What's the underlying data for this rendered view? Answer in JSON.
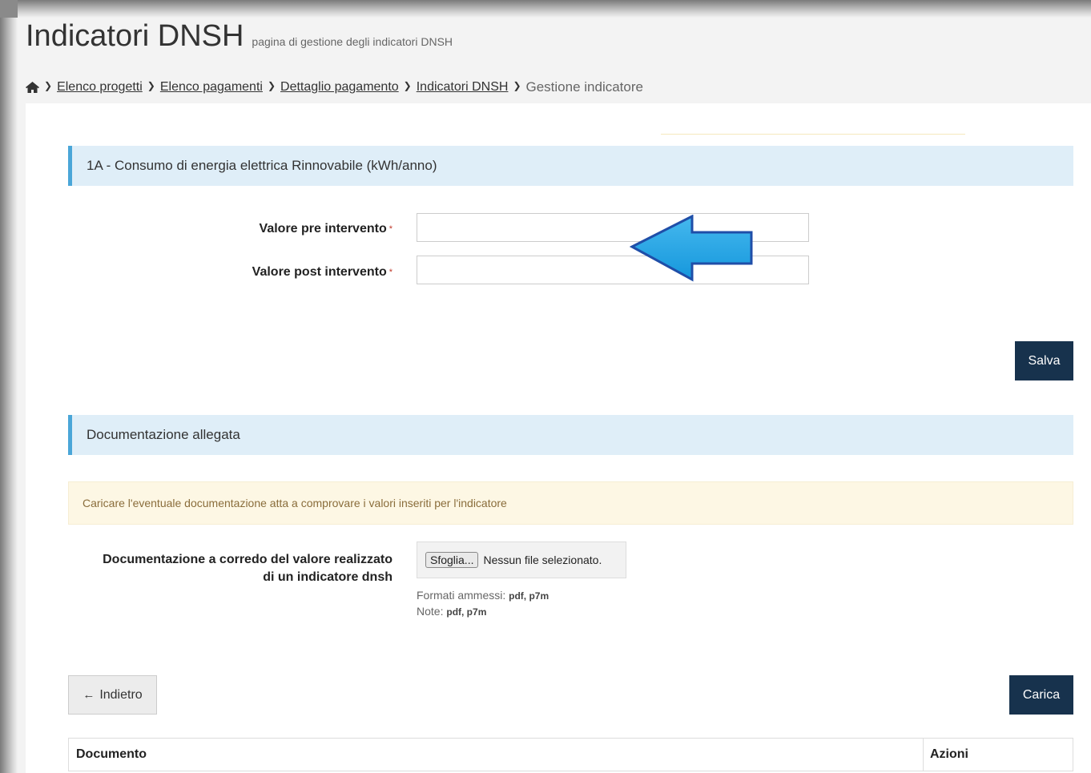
{
  "header": {
    "title": "Indicatori DNSH",
    "subtitle": "pagina di gestione degli indicatori DNSH"
  },
  "breadcrumb": {
    "items": [
      "Elenco progetti",
      "Elenco pagamenti",
      "Dettaglio pagamento",
      "Indicatori DNSH"
    ],
    "current": "Gestione indicatore"
  },
  "indicator_section": {
    "title": "1A - Consumo di energia elettrica Rinnovabile (kWh/anno)",
    "fields": [
      {
        "label": "Valore pre intervento",
        "value": "",
        "required": true
      },
      {
        "label": "Valore post intervento",
        "value": "",
        "required": true
      }
    ],
    "required_marker": "*",
    "save_label": "Salva"
  },
  "documents_section": {
    "title": "Documentazione allegata",
    "alert": "Caricare l'eventuale documentazione atta a comprovare i valori inseriti per l'indicatore",
    "upload_label": "Documentazione a corredo del valore realizzato di un indicatore dnsh",
    "browse_label": "Sfoglia...",
    "file_status": "Nessun file selezionato.",
    "formats_label": "Formati ammessi:",
    "formats_value": "pdf, p7m",
    "notes_label": "Note:",
    "notes_value": "pdf, p7m",
    "back_label": "Indietro",
    "upload_button": "Carica",
    "table_headers": [
      "Documento",
      "Azioni"
    ]
  },
  "colors": {
    "primary_button": "#17324d",
    "section_bar": "#dfeef8",
    "section_accent": "#4aa6d8",
    "alert_bg": "#fdf7e4",
    "alert_text": "#8a6d3b",
    "required": "#c0392b",
    "annotation_arrow": "#1ea4e6"
  },
  "icons": {
    "home": "home-icon",
    "separator": "chevron-right-icon",
    "back": "arrow-left-icon",
    "annotation": "left-arrow-annotation"
  }
}
